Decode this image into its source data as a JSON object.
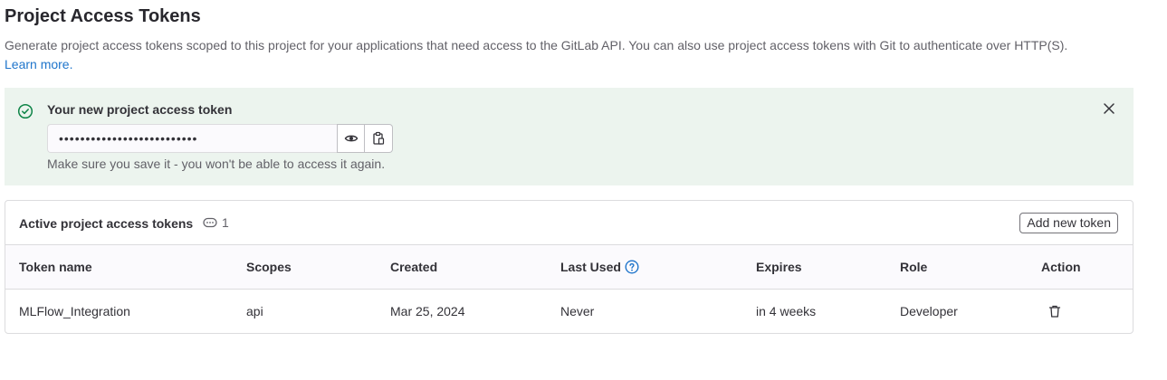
{
  "page": {
    "title": "Project Access Tokens",
    "description": "Generate project access tokens scoped to this project for your applications that need access to the GitLab API. You can also use project access tokens with Git to authenticate over HTTP(S).",
    "learn_more": "Learn more."
  },
  "alert": {
    "title": "Your new project access token",
    "token_value": "••••••••••••••••••••••••••",
    "help_text": "Make sure you save it - you won't be able to access it again.",
    "icons": {
      "status": "check-circle-icon",
      "reveal": "eye-icon",
      "copy": "clipboard-icon",
      "close": "close-icon"
    },
    "background": "#ecf4ee"
  },
  "tokens_card": {
    "title": "Active project access tokens",
    "count": "1",
    "count_icon": "token-icon",
    "add_button": "Add new token",
    "columns": [
      "Token name",
      "Scopes",
      "Created",
      "Last Used",
      "Expires",
      "Role",
      "Action"
    ],
    "rows": [
      {
        "name": "MLFlow_Integration",
        "scopes": "api",
        "created": "Mar 25, 2024",
        "last_used": "Never",
        "expires": "in 4 weeks",
        "role": "Developer",
        "action_icon": "trash-icon"
      }
    ]
  },
  "colors": {
    "link": "#1f75cb",
    "success": "#108548",
    "text": "#333238",
    "muted": "#626168"
  }
}
